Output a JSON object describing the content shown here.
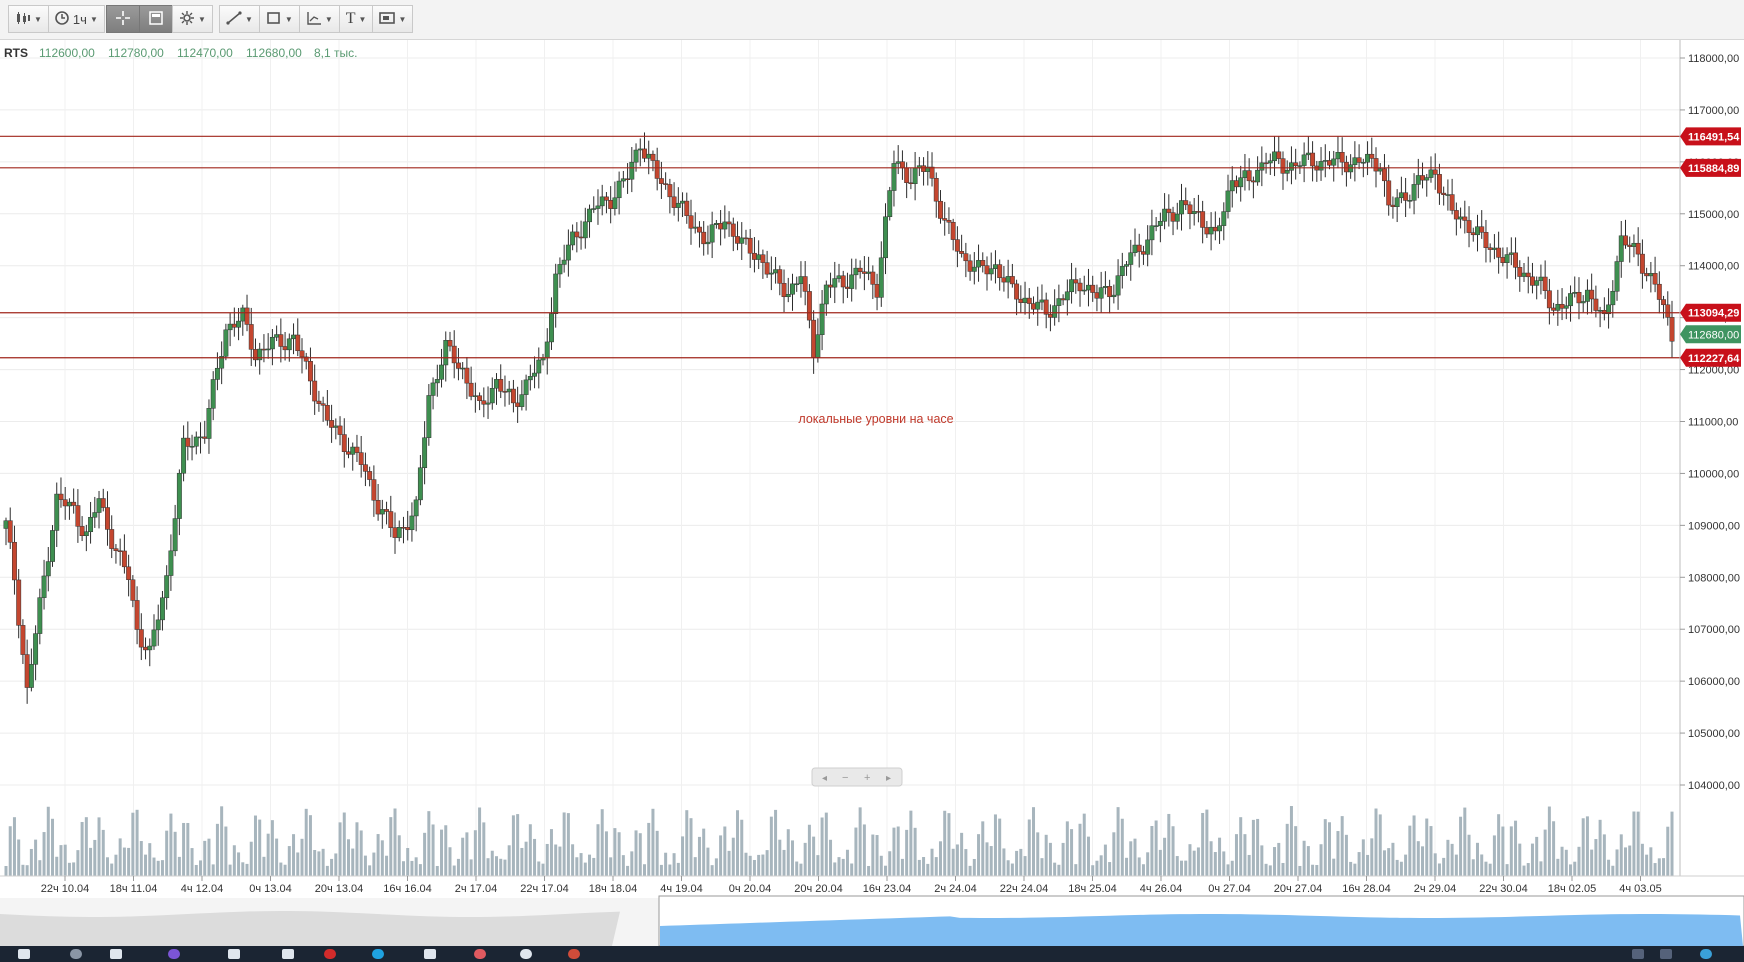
{
  "toolbar": {
    "interval_label": "1ч",
    "buttons": [
      "chart-type",
      "interval",
      "crosshair",
      "calculator",
      "indicators",
      "draw-line",
      "shapes",
      "fibonacci",
      "text",
      "image"
    ]
  },
  "header": {
    "symbol": "RTS",
    "open": "112600,00",
    "high": "112780,00",
    "low": "112470,00",
    "close": "112680,00",
    "volume": "8,1 тыс."
  },
  "annotation": "локальные уровни на часе",
  "colors": {
    "up": "#3e8f50",
    "down": "#c4462f",
    "level_line": "#a0261c",
    "level_badge": "#c8101a",
    "last_price_badge": "#3f9461",
    "volume": "#a7b5bd",
    "navigator_fill": "#7ebcf2"
  },
  "chart_data": {
    "type": "candlestick",
    "symbol": "RTS",
    "ylim": [
      104000,
      118400
    ],
    "y_ticks": [
      "118000,00",
      "117000,00",
      "116000,00",
      "115000,00",
      "114000,00",
      "113000,00",
      "112000,00",
      "111000,00",
      "110000,00",
      "109000,00",
      "108000,00",
      "107000,00",
      "106000,00",
      "105000,00",
      "104000,00"
    ],
    "x_ticks": [
      "22ч 10.04",
      "18ч 11.04",
      "4ч 12.04",
      "0ч 13.04",
      "20ч 13.04",
      "16ч 16.04",
      "2ч 17.04",
      "22ч 17.04",
      "18ч 18.04",
      "4ч 19.04",
      "0ч 20.04",
      "20ч 20.04",
      "16ч 23.04",
      "2ч 24.04",
      "22ч 24.04",
      "18ч 25.04",
      "4ч 26.04",
      "0ч 27.04",
      "20ч 27.04",
      "16ч 28.04",
      "2ч 29.04",
      "22ч 30.04",
      "18ч 02.05",
      "4ч 03.05"
    ],
    "levels": [
      {
        "value": 116491.54,
        "label": "116491,54"
      },
      {
        "value": 115884.89,
        "label": "115884,89"
      },
      {
        "value": 113094.29,
        "label": "113094,29"
      },
      {
        "value": 112227.64,
        "label": "112227,64"
      }
    ],
    "last_price": {
      "value": 112680,
      "label": "112680,00"
    },
    "anchors": [
      [
        0,
        109000
      ],
      [
        2,
        108000
      ],
      [
        5,
        105800
      ],
      [
        9,
        108000
      ],
      [
        12,
        109500
      ],
      [
        16,
        109300
      ],
      [
        19,
        108800
      ],
      [
        22,
        109500
      ],
      [
        26,
        108500
      ],
      [
        29,
        108000
      ],
      [
        31,
        107000
      ],
      [
        34,
        106500
      ],
      [
        38,
        108000
      ],
      [
        42,
        110500
      ],
      [
        47,
        110800
      ],
      [
        52,
        112800
      ],
      [
        56,
        113000
      ],
      [
        59,
        112300
      ],
      [
        63,
        112500
      ],
      [
        68,
        112600
      ],
      [
        71,
        112000
      ],
      [
        76,
        111000
      ],
      [
        80,
        110600
      ],
      [
        84,
        110200
      ],
      [
        88,
        109400
      ],
      [
        92,
        108800
      ],
      [
        97,
        109300
      ],
      [
        100,
        111500
      ],
      [
        104,
        112400
      ],
      [
        108,
        112000
      ],
      [
        112,
        111200
      ],
      [
        116,
        111800
      ],
      [
        120,
        111300
      ],
      [
        124,
        111900
      ],
      [
        127,
        112100
      ],
      [
        130,
        113800
      ],
      [
        134,
        114500
      ],
      [
        139,
        115100
      ],
      [
        143,
        115300
      ],
      [
        147,
        115700
      ],
      [
        150,
        116400
      ],
      [
        154,
        115700
      ],
      [
        158,
        115300
      ],
      [
        162,
        114800
      ],
      [
        166,
        114500
      ],
      [
        170,
        114900
      ],
      [
        174,
        114400
      ],
      [
        178,
        114200
      ],
      [
        181,
        113800
      ],
      [
        185,
        113500
      ],
      [
        188,
        113800
      ],
      [
        191,
        112400
      ],
      [
        194,
        113600
      ],
      [
        198,
        113700
      ],
      [
        202,
        113900
      ],
      [
        206,
        113600
      ],
      [
        210,
        116000
      ],
      [
        214,
        115700
      ],
      [
        218,
        115900
      ],
      [
        222,
        114800
      ],
      [
        226,
        114200
      ],
      [
        230,
        113900
      ],
      [
        234,
        114000
      ],
      [
        238,
        113500
      ],
      [
        242,
        113300
      ],
      [
        246,
        113100
      ],
      [
        250,
        113400
      ],
      [
        254,
        113700
      ],
      [
        258,
        113400
      ],
      [
        262,
        113600
      ],
      [
        266,
        114200
      ],
      [
        270,
        114500
      ],
      [
        274,
        115000
      ],
      [
        278,
        115100
      ],
      [
        282,
        115000
      ],
      [
        286,
        114500
      ],
      [
        290,
        115700
      ],
      [
        294,
        115600
      ],
      [
        298,
        116100
      ],
      [
        302,
        115900
      ],
      [
        306,
        116000
      ],
      [
        310,
        116000
      ],
      [
        314,
        116000
      ],
      [
        318,
        116000
      ],
      [
        322,
        116000
      ],
      [
        325,
        116000
      ],
      [
        327,
        115100
      ],
      [
        330,
        115300
      ],
      [
        334,
        115600
      ],
      [
        338,
        115800
      ],
      [
        342,
        115000
      ],
      [
        346,
        114800
      ],
      [
        350,
        114400
      ],
      [
        354,
        114200
      ],
      [
        358,
        113900
      ],
      [
        362,
        113700
      ],
      [
        366,
        113200
      ],
      [
        370,
        113300
      ],
      [
        374,
        113500
      ],
      [
        378,
        112900
      ],
      [
        382,
        114500
      ],
      [
        386,
        114200
      ],
      [
        390,
        113600
      ],
      [
        394,
        112700
      ]
    ]
  },
  "navigator": {
    "scroll_labels": [
      "◂",
      "−",
      "+",
      "▸"
    ]
  }
}
